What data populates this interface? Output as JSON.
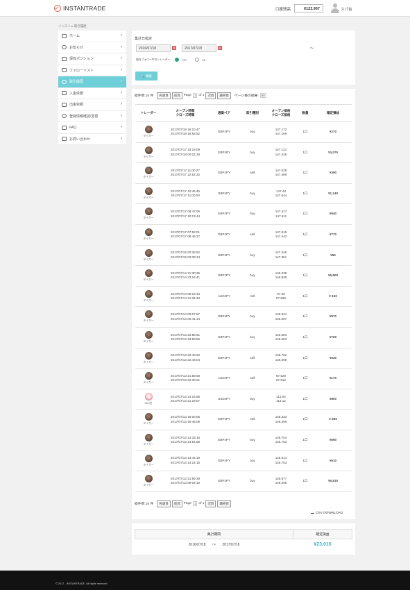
{
  "header": {
    "logo_text": "INSTANTRADE",
    "balance_label": "口座残高",
    "balance_value": "¥122,967",
    "user_name": "スパ吉"
  },
  "breadcrumb": "インスト ▸ 取引履歴",
  "sidebar": {
    "items": [
      {
        "label": "ホーム",
        "icon": "home-icon"
      },
      {
        "label": "お知らせ",
        "icon": "bell-icon"
      },
      {
        "label": "保有ポジション",
        "icon": "trend-icon"
      },
      {
        "label": "フォローリスト",
        "icon": "user-plus-icon"
      },
      {
        "label": "取引履歴",
        "icon": "clock-icon",
        "active": true
      },
      {
        "label": "入金依頼",
        "icon": "card-icon"
      },
      {
        "label": "出金依頼",
        "icon": "card-icon"
      },
      {
        "label": "登録情報確認/変更",
        "icon": "refresh-icon"
      },
      {
        "label": "FAQ",
        "icon": "faq-icon"
      },
      {
        "label": "お問い合わせ",
        "icon": "mail-icon"
      }
    ]
  },
  "filter": {
    "period_label": "集計日指定",
    "date_from": "2016/07/18",
    "date_to": "2017/07/18",
    "tilde": "〜",
    "follow_only_label": "現在フォロー中のトレーダー",
    "off_label": "OFF",
    "on_label": "ON",
    "search_label": "検索"
  },
  "pager": {
    "total": "総件数:18 件",
    "first": "先頭頁",
    "prev": "前頁",
    "page_word": "Page",
    "page_value": "1",
    "of_total": "of 1",
    "next": "次頁",
    "last": "最終頁",
    "per_page_label": "ページ毎の結果:",
    "per_page_value": "50"
  },
  "table": {
    "headers": {
      "trader": "トレーダー",
      "time_open": "オープン時間",
      "time_close": "クローズ時間",
      "pair": "通貨ペア",
      "type": "取引種別",
      "price_open": "オープン価格",
      "price_close": "クローズ価格",
      "qty": "数量",
      "pl": "確定損益"
    },
    "rows": [
      {
        "trader": "タイガー",
        "open": "2017/07/18 16:10:47",
        "close": "2017/07/18 16:55:52",
        "pair": "GBPJPY",
        "type": "buy",
        "p_open": "147.172",
        "p_close": "147.199",
        "qty": "1口",
        "pl": "¥270",
        "sign": "pos"
      },
      {
        "trader": "タイガー",
        "open": "2017/07/17 18:19:09",
        "close": "2017/07/18 00:01:29",
        "pair": "GBPJPY",
        "type": "buy",
        "p_open": "147.121",
        "p_close": "147.428",
        "qty": "1口",
        "pl": "¥3,070",
        "sign": "pos"
      },
      {
        "trader": "タイガー",
        "open": "2017/07/17 11:00:27",
        "close": "2017/07/17 12:52:32",
        "pair": "GBPJPY",
        "type": "sell",
        "p_open": "147.528",
        "p_close": "147.489",
        "qty": "1口",
        "pl": "¥390",
        "sign": "pos"
      },
      {
        "trader": "タイガー",
        "open": "2017/07/17 10:45:45",
        "close": "2017/07/17 11:00:00",
        "pair": "GBPJPY",
        "type": "buy",
        "p_open": "147.43",
        "p_close": "147.544",
        "qty": "1口",
        "pl": "¥1,140",
        "sign": "pos"
      },
      {
        "trader": "タイガー",
        "open": "2017/07/17 08:47:06",
        "close": "2017/07/17 10:13:44",
        "pair": "GBPJPY",
        "type": "buy",
        "p_open": "147.417",
        "p_close": "147.511",
        "qty": "1口",
        "pl": "¥940",
        "sign": "pos"
      },
      {
        "trader": "タイガー",
        "open": "2017/07/17 07:52:01",
        "close": "2017/07/17 08:46:37",
        "pair": "GBPJPY",
        "type": "sell",
        "p_open": "147.519",
        "p_close": "147.442",
        "qty": "1口",
        "pl": "¥770",
        "sign": "pos"
      },
      {
        "trader": "タイガー",
        "open": "2017/07/15 00:28:52",
        "close": "2017/07/15 03:33:13",
        "pair": "GBPJPY",
        "type": "buy",
        "p_open": "147.345",
        "p_close": "147.351",
        "qty": "1口",
        "pl": "¥60",
        "sign": "pos"
      },
      {
        "trader": "タイガー",
        "open": "2017/07/14 21:30:35",
        "close": "2017/07/14 23:16:41",
        "pair": "GBPJPY",
        "type": "buy",
        "p_open": "146.238",
        "p_close": "146.928",
        "qty": "1口",
        "pl": "¥6,900",
        "sign": "pos"
      },
      {
        "trader": "タイガー",
        "open": "2017/07/14 08:16:44",
        "close": "2017/07/14 21:34:43",
        "pair": "AUDJPY",
        "type": "sell",
        "p_open": "87.68",
        "p_close": "87.695",
        "qty": "1口",
        "pl": "¥-150",
        "sign": "neg"
      },
      {
        "trader": "タイガー",
        "open": "2017/07/14 00:07:57",
        "close": "2017/07/14 00:41:14",
        "pair": "GBPJPY",
        "type": "buy",
        "p_open": "146.624",
        "p_close": "146.567",
        "qty": "1口",
        "pl": "¥570",
        "sign": "pos"
      },
      {
        "trader": "タイガー",
        "open": "2017/07/13 22:58:31",
        "close": "2017/07/13 23:59:55",
        "pair": "GBPJPY",
        "type": "buy",
        "p_open": "146.583",
        "p_close": "146.653",
        "qty": "1口",
        "pl": "¥700",
        "sign": "pos"
      },
      {
        "trader": "タイガー",
        "open": "2017/07/13 22:40:22",
        "close": "2017/07/13 22:46:04",
        "pair": "GBPJPY",
        "type": "sell",
        "p_open": "146.762",
        "p_close": "146.699",
        "qty": "1口",
        "pl": "¥630",
        "sign": "pos"
      },
      {
        "trader": "タイガー",
        "open": "2017/07/13 21:59:58",
        "close": "2017/07/13 22:30:21",
        "pair": "AUDJPY",
        "type": "sell",
        "p_open": "87.529",
        "p_close": "87.512",
        "qty": "1口",
        "pl": "¥170",
        "sign": "pos"
      },
      {
        "trader": "MIU谷",
        "open": "2017/07/13 14:16:58",
        "close": "2017/07/13 21:19:07",
        "pair": "USDJPY",
        "type": "buy",
        "p_open": "113.04",
        "p_close": "113.12",
        "qty": "1口",
        "pl": "¥800",
        "sign": "pos",
        "alt": true
      },
      {
        "trader": "タイガー",
        "open": "2017/07/13 16:00:05",
        "close": "2017/07/13 16:46:09",
        "pair": "GBPJPY",
        "type": "sell",
        "p_open": "146.333",
        "p_close": "146.359",
        "qty": "1口",
        "pl": "¥-260",
        "sign": "neg"
      },
      {
        "trader": "タイガー",
        "open": "2017/07/13 14:33:15",
        "close": "2017/07/13 14:54:59",
        "pair": "GBPJPY",
        "type": "buy",
        "p_open": "145.704",
        "p_close": "145.763",
        "qty": "1口",
        "pl": "¥590",
        "sign": "pos"
      },
      {
        "trader": "タイガー",
        "open": "2017/07/13 13:44:19",
        "close": "2017/07/13 14:24:15",
        "pair": "GBPJPY",
        "type": "buy",
        "p_open": "145.614",
        "p_close": "145.753",
        "qty": "1口",
        "pl": "¥610",
        "sign": "pos"
      },
      {
        "trader": "タイガー",
        "open": "2017/07/12 21:59:39",
        "close": "2017/07/13 09:04:19",
        "pair": "GBPJPY",
        "type": "buy",
        "p_open": "145.677",
        "p_close": "146.258",
        "qty": "1口",
        "pl": "¥5,810",
        "sign": "pos"
      }
    ]
  },
  "csv_label": "CSV DOWNLOAD",
  "summary": {
    "period_header": "集計期間",
    "pl_header": "確定損益",
    "from": "2016/07/18",
    "tilde": "〜",
    "to": "2017/07/18",
    "total": "¥23,010"
  },
  "footer": {
    "copyright": "© 2017 - INSTANTRADE, All rights reserved."
  },
  "colors": {
    "accent": "#6fcfd8",
    "buy": "#48b3c8",
    "sell": "#d8403a",
    "footer": "#121212"
  }
}
